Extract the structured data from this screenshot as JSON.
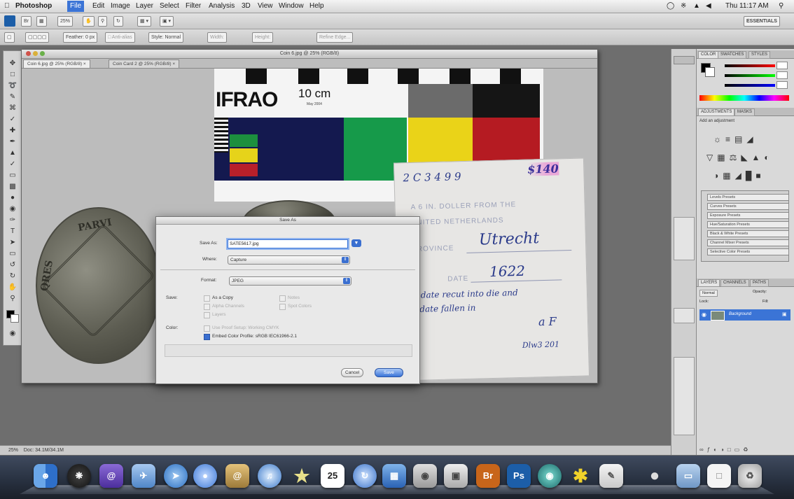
{
  "menubar": {
    "items": [
      "Photoshop",
      "File",
      "Edit",
      "Image",
      "Layer",
      "Select",
      "Filter",
      "Analysis",
      "3D",
      "View",
      "Window",
      "Help"
    ],
    "clock": "Thu 11:17 AM",
    "active_item": "File"
  },
  "appbar": {
    "zoom": "25%",
    "workspace": "ESSENTIALS"
  },
  "optionsbar": {
    "feather": "Feather: 0 px",
    "style": "Style: Normal",
    "width_label": "Width:",
    "height_label": "Height:",
    "refine": "Refine Edge..."
  },
  "document": {
    "window_title": "Coin 6.jpg @ 25% (RGB/8)",
    "tabs": [
      "Coin 6.jpg @ 25% (RGB/8) ×",
      "Coin Card 2 @ 25% (RGB/8) ×"
    ],
    "status_zoom": "25%",
    "status_doc": "Doc: 34.1M/34.1M"
  },
  "scale_card": {
    "brand": "IFRAO",
    "size": "10 cm",
    "sub": "May 2004"
  },
  "index_card": {
    "number": "2 C 3 4 9 9",
    "price": "$140",
    "line1": "A 6 IN. DOLLER FROM THE",
    "line2": "UNITED NETHERLANDS",
    "line3_label": "PROVINCE",
    "line3_value": "Utrecht",
    "line4_label": "DATE",
    "line4_value": "1622",
    "note1": "2nd date recut into die and",
    "note2": "3rd date fallen in",
    "grade": "a F",
    "ref": "Dlw3 201"
  },
  "coin_text": {
    "left_rim": "PARVI",
    "left_side": "QRES"
  },
  "dialog": {
    "title": "Save As",
    "save_as_label": "Save As:",
    "filename": "SATE5617.jpg",
    "where_label": "Where:",
    "where_value": "Capture",
    "format_label": "Format:",
    "format_value": "JPEG",
    "save_label": "Save:",
    "as_copy": "As a Copy",
    "notes": "Notes",
    "alpha": "Alpha Channels",
    "spot": "Spot Colors",
    "layers": "Layers",
    "color_label": "Color:",
    "use_proof": "Use Proof Setup:  Working CMYK",
    "embed": "Embed Color Profile:  sRGB IEC61966-2.1",
    "cancel": "Cancel",
    "save": "Save"
  },
  "color_panel": {
    "tabs": [
      "COLOR",
      "SWATCHES",
      "STYLES"
    ]
  },
  "adjust_panel": {
    "tabs": [
      "ADJUSTMENTS",
      "MASKS"
    ],
    "title": "Add an adjustment",
    "presets": [
      "Levels Presets",
      "Curves Presets",
      "Exposure Presets",
      "Hue/Saturation Presets",
      "Black & White Presets",
      "Channel Mixer Presets",
      "Selective Color Presets"
    ]
  },
  "layers_panel": {
    "tabs": [
      "LAYERS",
      "CHANNELS",
      "PATHS"
    ],
    "mode": "Normal",
    "opacity": "Opacity:",
    "lock": "Lock:",
    "fill": "Fill:",
    "layer_name": "Background"
  },
  "dock": {
    "apps": [
      "Finder",
      "Dashboard",
      "Mail",
      "iChat",
      "Safari",
      "Address Book",
      "iTunes",
      "Calendar",
      "Preview",
      "Bridge",
      "Photoshop",
      "Utility",
      "Trash"
    ],
    "calendar_day": "25",
    "bridge_label": "Br",
    "ps_label": "Ps"
  },
  "colors": {
    "accent": "#3b74d6",
    "bridge": "#c8651a",
    "photoshop": "#1c5ea8"
  }
}
